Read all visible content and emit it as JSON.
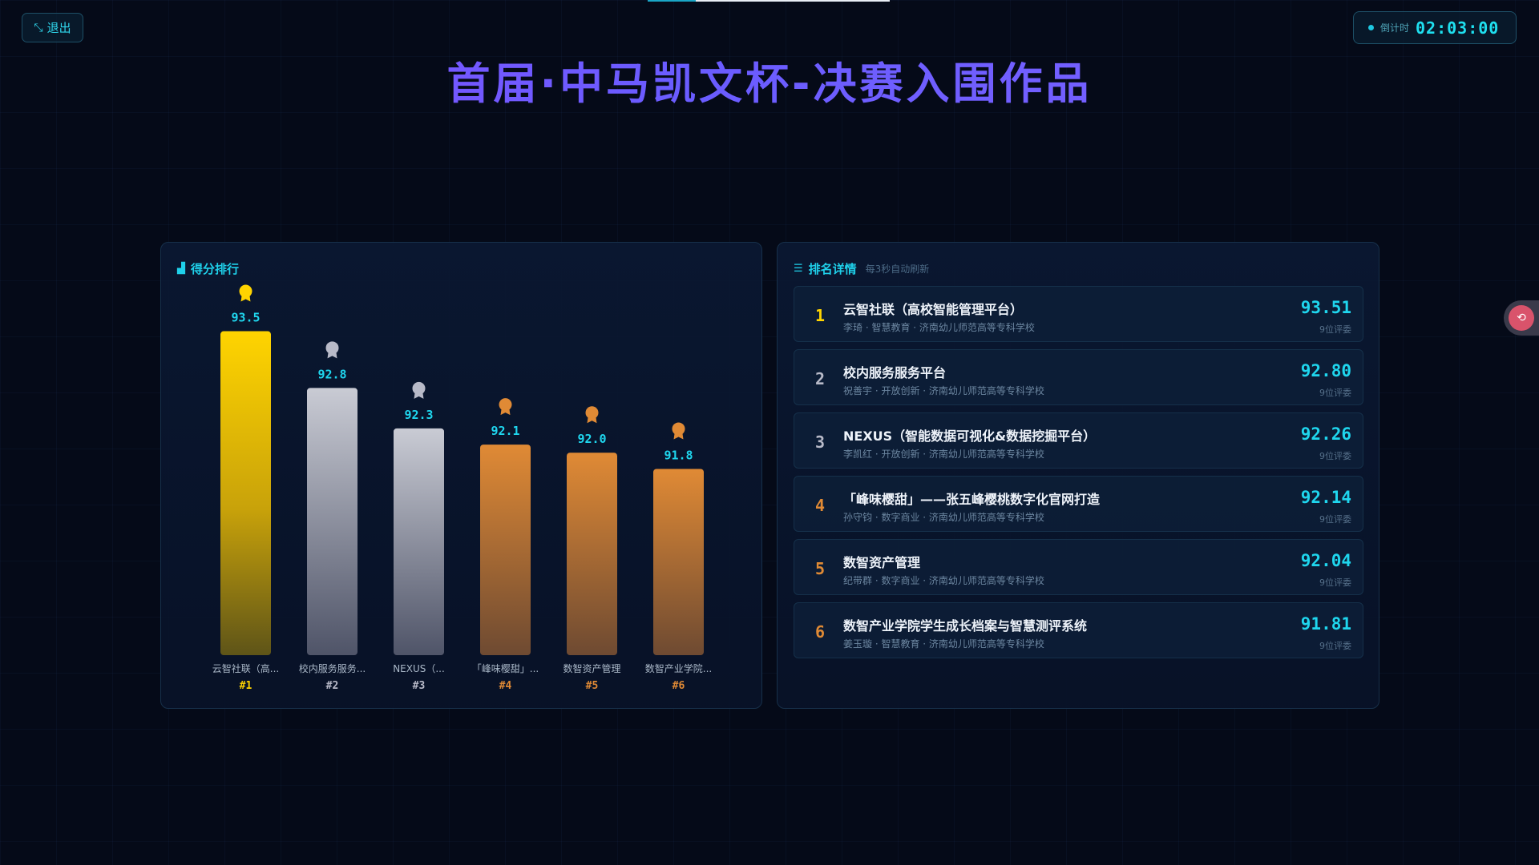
{
  "header": {
    "exit_label": "退出",
    "countdown_label": "倒计时",
    "countdown_time": "02:03:00",
    "title": "首届·中马凯文杯-决赛入围作品"
  },
  "left_panel": {
    "title": "得分排行"
  },
  "right_panel": {
    "title": "排名详情",
    "subtitle": "每3秒自动刷新"
  },
  "colors": {
    "gold": "#ffd400",
    "silver": "#b8bac8",
    "bronze": "#e08a35",
    "cyan": "#1fd6ee"
  },
  "chart_data": {
    "type": "bar",
    "categories": [
      "云智社联（高...",
      "校内服务服务...",
      "NEXUS（...",
      "「峰味樱甜」...",
      "数智资产管理",
      "数智产业学院..."
    ],
    "rank_labels": [
      "#1",
      "#2",
      "#3",
      "#4",
      "#5",
      "#6"
    ],
    "values": [
      93.5,
      92.8,
      92.3,
      92.1,
      92.0,
      91.8
    ],
    "value_labels": [
      "93.5",
      "92.8",
      "92.3",
      "92.1",
      "92.0",
      "91.8"
    ],
    "tiers": [
      "gold",
      "silver",
      "silver",
      "bronze",
      "bronze",
      "bronze"
    ],
    "ylim": [
      89.5,
      94
    ]
  },
  "rankings": [
    {
      "rank": "1",
      "name": "云智社联（高校智能管理平台）",
      "meta": "李琦 · 智慧教育 · 济南幼儿师范高等专科学校",
      "score": "93.51",
      "judges": "9位评委",
      "tier": "gold"
    },
    {
      "rank": "2",
      "name": "校内服务服务平台",
      "meta": "祝善宇 · 开放创新 · 济南幼儿师范高等专科学校",
      "score": "92.80",
      "judges": "9位评委",
      "tier": "silver"
    },
    {
      "rank": "3",
      "name": "NEXUS（智能数据可视化&数据挖掘平台）",
      "meta": "李凯红 · 开放创新 · 济南幼儿师范高等专科学校",
      "score": "92.26",
      "judges": "9位评委",
      "tier": "silver"
    },
    {
      "rank": "4",
      "name": "「峰味樱甜」——张五峰樱桃数字化官网打造",
      "meta": "孙守钧 · 数字商业 · 济南幼儿师范高等专科学校",
      "score": "92.14",
      "judges": "9位评委",
      "tier": "bronze"
    },
    {
      "rank": "5",
      "name": "数智资产管理",
      "meta": "纪带群 · 数字商业 · 济南幼儿师范高等专科学校",
      "score": "92.04",
      "judges": "9位评委",
      "tier": "bronze"
    },
    {
      "rank": "6",
      "name": "数智产业学院学生成长档案与智慧测评系统",
      "meta": "姜玉璇 · 智慧教育 · 济南幼儿师范高等专科学校",
      "score": "91.81",
      "judges": "9位评委",
      "tier": "bronze"
    }
  ]
}
